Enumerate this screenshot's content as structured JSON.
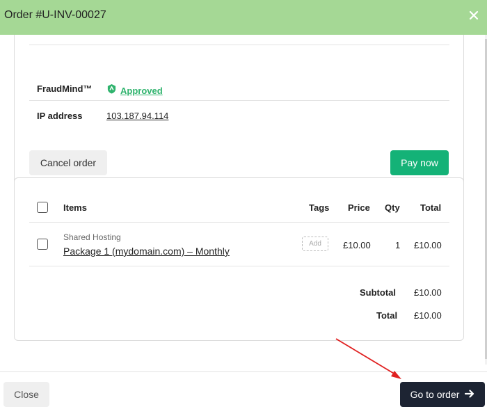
{
  "window": {
    "title": "Order #U-INV-00027",
    "close_icon": "close-icon"
  },
  "summary": {
    "fraud_label": "FraudMind™",
    "fraud_status": "Approved",
    "fraud_icon": "shield-icon",
    "ip_label": "IP address",
    "ip_value": "103.187.94.114",
    "cancel_label": "Cancel order",
    "pay_label": "Pay now"
  },
  "items_table": {
    "headers": {
      "items": "Items",
      "tags": "Tags",
      "price": "Price",
      "qty": "Qty",
      "total": "Total"
    },
    "rows": [
      {
        "category": "Shared Hosting",
        "name": "Package 1 (mydomain.com) – Monthly",
        "tag_action": "Add",
        "price": "£10.00",
        "qty": "1",
        "total": "£10.00"
      }
    ],
    "subtotal_label": "Subtotal",
    "subtotal_value": "£10.00",
    "total_label": "Total",
    "total_value": "£10.00"
  },
  "footer": {
    "close_label": "Close",
    "goto_label": "Go to order",
    "goto_icon": "arrow-right-icon"
  },
  "colors": {
    "header_bg": "#a5d895",
    "approved": "#2fb36d",
    "pay_button": "#14b277",
    "goto_button": "#1d2433",
    "annotation_arrow": "#e02020"
  }
}
